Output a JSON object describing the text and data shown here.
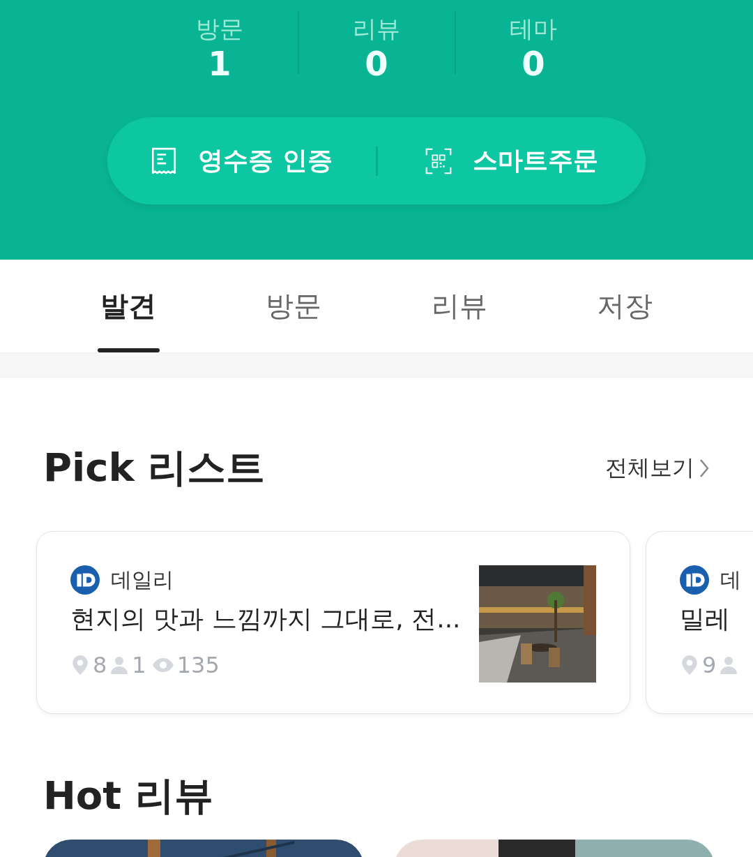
{
  "stats": [
    {
      "label": "방문",
      "value": "1"
    },
    {
      "label": "리뷰",
      "value": "0"
    },
    {
      "label": "테마",
      "value": "0"
    }
  ],
  "actions": [
    {
      "kind": "receipt",
      "label": "영수증 인증"
    },
    {
      "kind": "qr",
      "label": "스마트주문"
    }
  ],
  "tabs": [
    {
      "label": "발견",
      "selected": true
    },
    {
      "label": "방문",
      "selected": false
    },
    {
      "label": "리뷰",
      "selected": false
    },
    {
      "label": "저장",
      "selected": false
    }
  ],
  "pick_list": {
    "title": "Pick 리스트",
    "see_all": "전체보기",
    "cards": [
      {
        "source": "데일리",
        "title": "현지의 맛과 느낌까지 그대로, 전...",
        "places": "8",
        "followers": "1",
        "views": "135"
      },
      {
        "source": "데",
        "title": "밀레",
        "places": "9"
      }
    ]
  },
  "hot_reviews": {
    "title": "Hot 리뷰"
  }
}
